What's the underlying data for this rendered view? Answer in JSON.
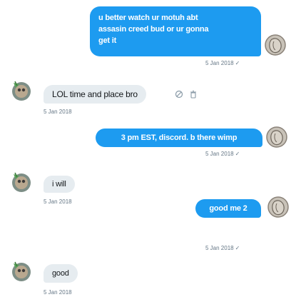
{
  "messages": [
    {
      "direction": "sent",
      "text": "u better watch ur motuh abt\nassasin creed bud or ur gonna\nget it",
      "date": "5 Jan 2018",
      "status": "✓"
    },
    {
      "direction": "received",
      "text": "LOL time and place bro",
      "date": "5 Jan 2018"
    },
    {
      "direction": "sent",
      "text": "3 pm EST, discord. b there wimp",
      "date": "5 Jan 2018",
      "status": "✓"
    },
    {
      "direction": "received",
      "text": "i will",
      "date": "5 Jan 2018"
    },
    {
      "direction": "sent",
      "text": "good me 2",
      "date": "5 Jan 2018",
      "status": "✓"
    },
    {
      "direction": "received",
      "text": "good",
      "date": "5 Jan 2018"
    }
  ],
  "hover_actions": {
    "icons": [
      "no-entry-icon",
      "trash-icon"
    ]
  },
  "colors": {
    "sent_bubble": "#1d9bf0",
    "received_bubble": "#e6ecf0",
    "meta_text": "#657786"
  }
}
